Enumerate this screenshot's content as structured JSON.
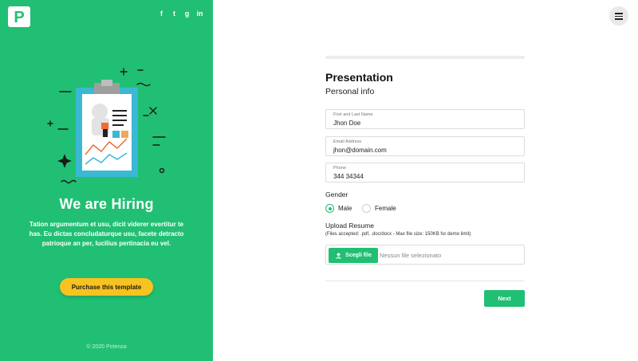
{
  "left_panel": {
    "brand_letter": "P",
    "socials": [
      {
        "icon": "facebook-icon",
        "glyph": "f"
      },
      {
        "icon": "twitter-icon",
        "glyph": "t"
      },
      {
        "icon": "google-plus-icon",
        "glyph": "g"
      },
      {
        "icon": "linkedin-icon",
        "glyph": "in"
      }
    ],
    "title": "We are Hiring",
    "description": "Tation argumentum et usu, dicit viderer evertitur te has. Eu dictas concludaturque usu, facete detracto patrioque an per, lucilius pertinacia eu vel.",
    "purchase_label": "Purchase this template",
    "copyright": "© 2020 Potenza"
  },
  "colors": {
    "brand_green": "#21bf73",
    "accent_yellow": "#f9c31f"
  },
  "form": {
    "title": "Presentation",
    "subtitle": "Personal info",
    "fields": {
      "name": {
        "label": "First and Last Name",
        "value": "Jhon Doe"
      },
      "email": {
        "label": "Email Address",
        "value": "jhon@domain.com"
      },
      "phone": {
        "label": "Phone",
        "value": "344 34344"
      }
    },
    "gender": {
      "label": "Gender",
      "options": [
        {
          "label": "Male",
          "selected": true
        },
        {
          "label": "Female",
          "selected": false
        }
      ]
    },
    "upload": {
      "label": "Upload Resume",
      "hint": "(Files accepted: .pdf, .doc/docx - Max file size: 150KB for demo limit)",
      "button_label": "Scegli file",
      "status": "Nessun file selezionato"
    },
    "next_label": "Next"
  }
}
